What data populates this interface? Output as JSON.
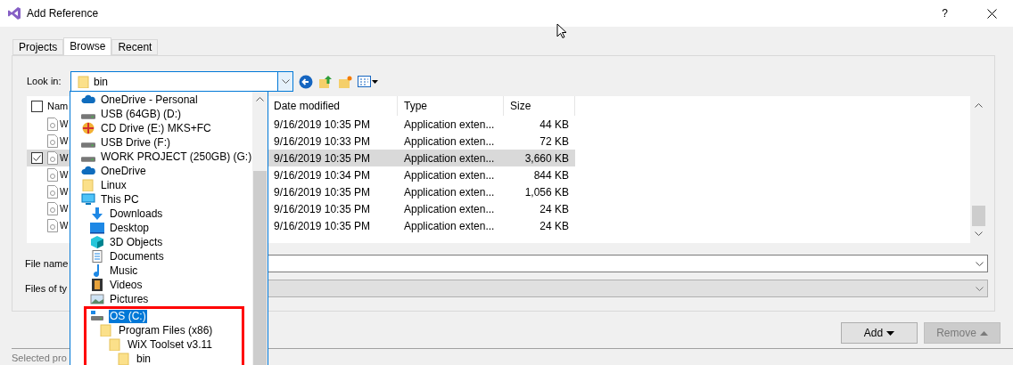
{
  "window": {
    "title": "Add Reference",
    "help": "?"
  },
  "tabs": [
    {
      "label": "Projects",
      "selected": false
    },
    {
      "label": "Browse",
      "selected": true
    },
    {
      "label": "Recent",
      "selected": false
    }
  ],
  "look_in": {
    "label": "Look in:",
    "value": "bin"
  },
  "file_list": {
    "columns": [
      "Nam",
      "Date modified",
      "Type",
      "Size"
    ],
    "rows": [
      {
        "name": "W",
        "date": "9/16/2019 10:35 PM",
        "type": "Application exten...",
        "size": "44 KB",
        "checked": false,
        "selected": false
      },
      {
        "name": "W",
        "date": "9/16/2019 10:33 PM",
        "type": "Application exten...",
        "size": "72 KB",
        "checked": false,
        "selected": false
      },
      {
        "name": "W",
        "date": "9/16/2019 10:35 PM",
        "type": "Application exten...",
        "size": "3,660 KB",
        "checked": true,
        "selected": true
      },
      {
        "name": "W",
        "date": "9/16/2019 10:34 PM",
        "type": "Application exten...",
        "size": "844 KB",
        "checked": false,
        "selected": false
      },
      {
        "name": "W",
        "date": "9/16/2019 10:35 PM",
        "type": "Application exten...",
        "size": "1,056 KB",
        "checked": false,
        "selected": false
      },
      {
        "name": "W",
        "date": "9/16/2019 10:35 PM",
        "type": "Application exten...",
        "size": "24 KB",
        "checked": false,
        "selected": false
      },
      {
        "name": "W",
        "date": "9/16/2019 10:35 PM",
        "type": "Application exten...",
        "size": "24 KB",
        "checked": false,
        "selected": false
      }
    ]
  },
  "select_all": {
    "checked": false
  },
  "file_name": {
    "label": "File name"
  },
  "files_of_type": {
    "label": "Files of ty",
    "disabled": true
  },
  "buttons": [
    {
      "label": "Add",
      "disabled": false
    },
    {
      "label": "Remove",
      "disabled": true
    }
  ],
  "status": "Selected pro",
  "dropdown": [
    {
      "label": "OneDrive - Personal",
      "kind": "cloud",
      "selected": false,
      "marked": false
    },
    {
      "label": "USB (64GB) (D:)",
      "kind": "drive",
      "selected": false,
      "marked": false
    },
    {
      "label": "CD Drive (E:) MKS+FC",
      "kind": "cd",
      "selected": false,
      "marked": false
    },
    {
      "label": "USB Drive (F:)",
      "kind": "drive",
      "selected": false,
      "marked": false
    },
    {
      "label": "WORK PROJECT (250GB) (G:)",
      "kind": "drive",
      "selected": false,
      "marked": false
    },
    {
      "label": "OneDrive",
      "kind": "cloud",
      "selected": false,
      "marked": false
    },
    {
      "label": "Linux",
      "kind": "folder",
      "selected": false,
      "marked": false
    },
    {
      "label": "This PC",
      "kind": "pc",
      "selected": false,
      "marked": false,
      "children": [
        {
          "label": "Downloads",
          "kind": "downloads",
          "selected": false,
          "marked": false
        },
        {
          "label": "Desktop",
          "kind": "desktop",
          "selected": false,
          "marked": false
        },
        {
          "label": "3D Objects",
          "kind": "objects",
          "selected": false,
          "marked": false
        },
        {
          "label": "Documents",
          "kind": "documents",
          "selected": false,
          "marked": false
        },
        {
          "label": "Music",
          "kind": "music",
          "selected": false,
          "marked": false
        },
        {
          "label": "Videos",
          "kind": "videos",
          "selected": false,
          "marked": false
        },
        {
          "label": "Pictures",
          "kind": "pictures",
          "selected": false,
          "marked": false
        },
        {
          "label": "OS (C:)",
          "kind": "os",
          "selected": true,
          "marked": true,
          "children": [
            {
              "label": "Program Files (x86)",
              "kind": "folder",
              "selected": false,
              "marked": false,
              "children": [
                {
                  "label": "WiX Toolset v3.11",
                  "kind": "folder",
                  "selected": false,
                  "marked": false,
                  "children": [
                    {
                      "label": "bin",
                      "kind": "folder",
                      "selected": false,
                      "marked": false
                    }
                  ]
                }
              ]
            }
          ]
        }
      ]
    }
  ]
}
